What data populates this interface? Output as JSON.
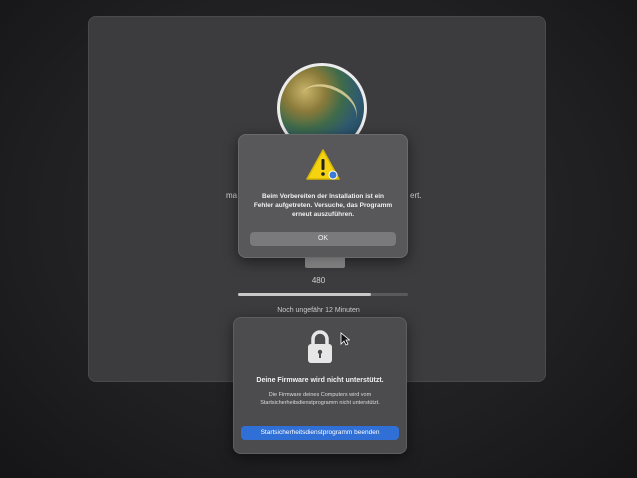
{
  "installer": {
    "side_text_left": "ma",
    "side_text_right": "ert.",
    "disk_label": "480",
    "progress_fraction": 0.78,
    "progress_text": "Noch ungefähr 12 Minuten"
  },
  "alert": {
    "icon": "warning-icon",
    "message": "Beim Vorbereiten der Installation ist ein Fehler aufgetreten. Versuche, das Programm erneut auszuführen.",
    "ok_label": "OK"
  },
  "firmware_dialog": {
    "icon": "lock-icon",
    "title": "Deine Firmware wird nicht unterstützt.",
    "description": "Die Firmware deines Computers wird vom Startsicherheitsdienstprogramm nicht unterstützt.",
    "button_label": "Startsicherheitsdienstprogramm beenden"
  },
  "colors": {
    "accent": "#2f6fd6",
    "warning": "#f5d311"
  }
}
